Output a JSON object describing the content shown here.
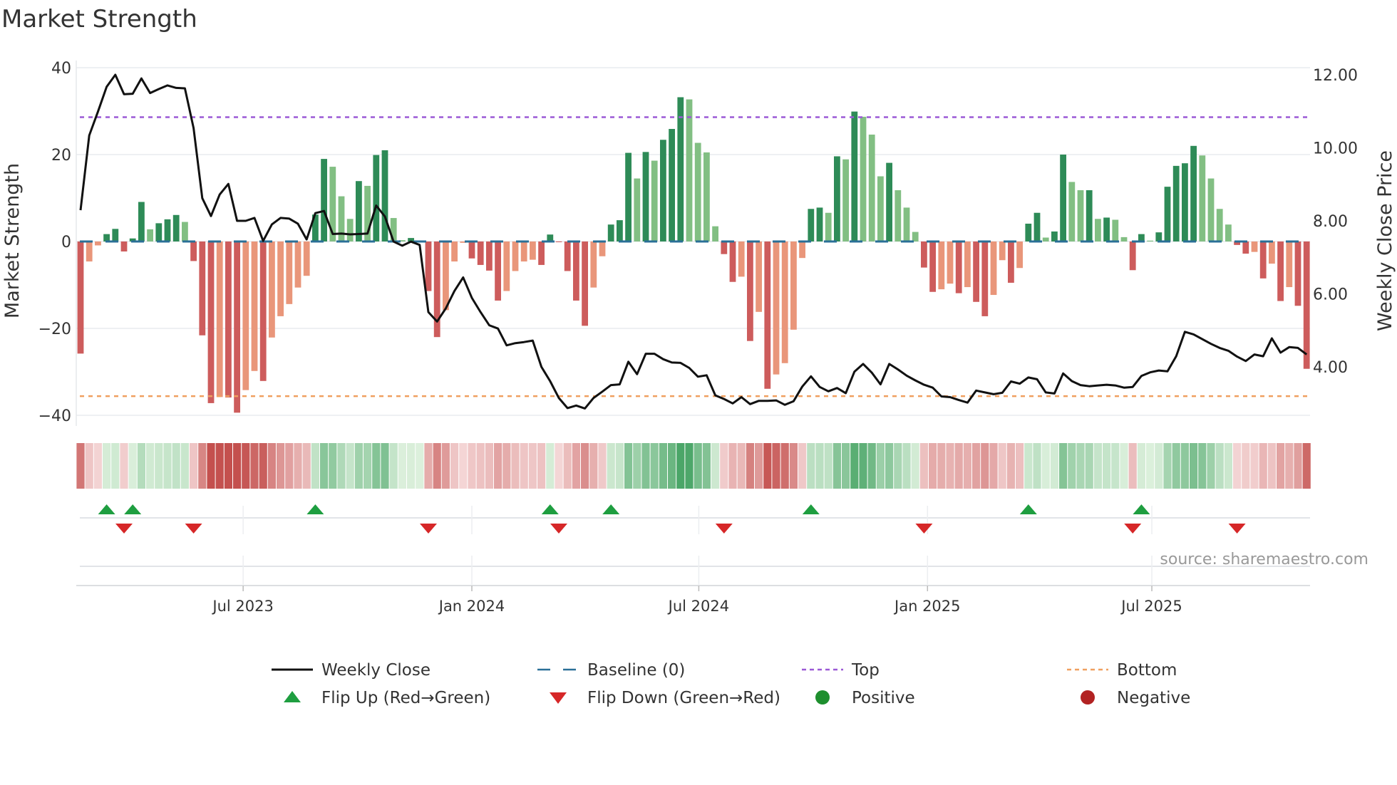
{
  "chart_data": {
    "type": "bar",
    "title": "Market Strength",
    "ylabel": "Market Strength",
    "y2label": "Weekly Close Price",
    "source": "source: sharemaestro.com",
    "ylim": [
      -40,
      40
    ],
    "y_ticks": [
      {
        "v": 40,
        "label": "40"
      },
      {
        "v": 20,
        "label": "20"
      },
      {
        "v": 0,
        "label": "0"
      },
      {
        "v": -20,
        "label": "−20"
      },
      {
        "v": -40,
        "label": "−40"
      }
    ],
    "y2_ticks": [
      {
        "v": 12,
        "label": "12.00"
      },
      {
        "v": 10,
        "label": "10.00"
      },
      {
        "v": 8,
        "label": "8.00"
      },
      {
        "v": 6,
        "label": "6.00"
      },
      {
        "v": 4,
        "label": "4.00"
      }
    ],
    "x_ticks": [
      {
        "week": 18.7,
        "label": "Jul 2023"
      },
      {
        "week": 45.0,
        "label": "Jan 2024"
      },
      {
        "week": 71.1,
        "label": "Jul 2024"
      },
      {
        "week": 97.4,
        "label": "Jan 2025"
      },
      {
        "week": 123.2,
        "label": "Jul 2025"
      }
    ],
    "top_level": 28.6,
    "bottom_level": -35.6,
    "baseline": 0,
    "colors": {
      "green_rising": "#2e8b57",
      "green_falling": "#82bf83",
      "red_falling": "#cd5c5c",
      "red_rising": "#e9967a",
      "close": "#111111",
      "baseline": "#2a6f97",
      "top": "#9b59d6",
      "bottom": "#f0a060",
      "flip_up": "#1e9e40",
      "flip_down": "#d62728",
      "positive": "#1e8f2e",
      "negative": "#b22222"
    },
    "strength": [
      -25.8,
      -4.6,
      -0.9,
      1.7,
      2.9,
      -2.3,
      0.7,
      9.1,
      2.8,
      4.2,
      5.1,
      6.1,
      4.5,
      -4.5,
      -21.6,
      -37.2,
      -35.8,
      -35.9,
      -39.4,
      -34.2,
      -29.8,
      -32.1,
      -22.1,
      -17.2,
      -14.4,
      -10.6,
      -7.9,
      6.2,
      19.0,
      17.2,
      10.4,
      5.2,
      13.9,
      12.8,
      19.9,
      21.0,
      5.4,
      0.3,
      0.8,
      0.1,
      -11.4,
      -22.0,
      -15.8,
      -4.6,
      -0.3,
      -3.9,
      -5.4,
      -6.7,
      -13.6,
      -11.4,
      -6.8,
      -4.6,
      -4.2,
      -5.4,
      1.6,
      -0.1,
      -6.8,
      -13.6,
      -19.4,
      -10.6,
      -3.4,
      3.9,
      4.9,
      20.4,
      14.5,
      20.6,
      18.6,
      23.4,
      25.9,
      33.2,
      32.7,
      22.7,
      20.5,
      3.5,
      -2.9,
      -9.3,
      -8.1,
      -22.9,
      -16.2,
      -33.9,
      -30.6,
      -28.0,
      -20.3,
      -3.8,
      7.5,
      7.8,
      6.6,
      19.6,
      18.9,
      29.9,
      28.7,
      24.6,
      15.0,
      18.1,
      11.8,
      7.8,
      2.2,
      -6.0,
      -11.6,
      -11.0,
      -9.7,
      -11.9,
      -10.5,
      -13.9,
      -17.2,
      -12.3,
      -4.3,
      -9.5,
      -6.1,
      4.1,
      6.6,
      0.9,
      2.3,
      20.0,
      13.7,
      11.8,
      11.8,
      5.2,
      5.5,
      5.0,
      1.0,
      -6.6,
      1.7,
      0.2,
      2.1,
      12.6,
      17.4,
      18.0,
      22.0,
      19.8,
      14.5,
      7.5,
      3.9,
      -0.8,
      -2.8,
      -2.4,
      -8.5,
      -5.1,
      -13.7,
      -10.5,
      -14.8,
      -29.3
    ],
    "weekly_close": [
      8.29,
      10.34,
      10.99,
      11.67,
      12.0,
      11.47,
      11.48,
      11.9,
      11.5,
      11.61,
      11.71,
      11.64,
      11.63,
      10.54,
      8.62,
      8.13,
      8.72,
      9.01,
      8.0,
      8.0,
      8.08,
      7.45,
      7.9,
      8.08,
      8.06,
      7.92,
      7.49,
      8.21,
      8.27,
      7.64,
      7.65,
      7.63,
      7.64,
      7.65,
      8.42,
      8.12,
      7.43,
      7.32,
      7.43,
      7.34,
      5.5,
      5.24,
      5.6,
      6.08,
      6.45,
      5.89,
      5.5,
      5.14,
      5.05,
      4.59,
      4.65,
      4.68,
      4.72,
      4.0,
      3.61,
      3.15,
      2.87,
      2.94,
      2.86,
      3.15,
      3.32,
      3.5,
      3.52,
      4.14,
      3.8,
      4.36,
      4.36,
      4.21,
      4.12,
      4.11,
      3.97,
      3.73,
      3.77,
      3.22,
      3.12,
      3.0,
      3.17,
      2.98,
      3.07,
      3.07,
      3.08,
      2.96,
      3.06,
      3.46,
      3.74,
      3.45,
      3.33,
      3.42,
      3.28,
      3.87,
      4.08,
      3.84,
      3.52,
      4.08,
      3.93,
      3.76,
      3.63,
      3.51,
      3.43,
      3.19,
      3.17,
      3.09,
      3.02,
      3.35,
      3.3,
      3.25,
      3.29,
      3.6,
      3.54,
      3.71,
      3.66,
      3.3,
      3.27,
      3.82,
      3.61,
      3.5,
      3.47,
      3.49,
      3.51,
      3.49,
      3.43,
      3.45,
      3.75,
      3.85,
      3.9,
      3.88,
      4.29,
      4.96,
      4.89,
      4.76,
      4.63,
      4.52,
      4.44,
      4.28,
      4.16,
      4.34,
      4.29,
      4.78,
      4.39,
      4.54,
      4.52,
      4.34
    ],
    "legend": [
      {
        "key": "close",
        "label": "Weekly Close"
      },
      {
        "key": "baseline",
        "label": "Baseline (0)"
      },
      {
        "key": "top",
        "label": "Top"
      },
      {
        "key": "bottom",
        "label": "Bottom"
      },
      {
        "key": "flip_up",
        "label": "Flip Up (Red→Green)"
      },
      {
        "key": "flip_down",
        "label": "Flip Down (Green→Red)"
      },
      {
        "key": "positive",
        "label": "Positive"
      },
      {
        "key": "negative",
        "label": "Negative"
      }
    ]
  }
}
